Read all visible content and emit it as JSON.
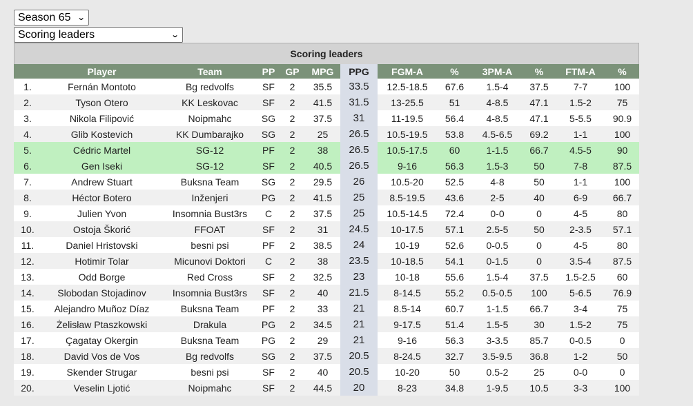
{
  "season_select": {
    "value": "Season 65"
  },
  "category_select": {
    "value": "Scoring leaders"
  },
  "table": {
    "caption": "Scoring leaders",
    "headers": [
      "",
      "Player",
      "Team",
      "PP",
      "GP",
      "MPG",
      "PPG",
      "FGM-A",
      "%",
      "3PM-A",
      "%",
      "FTM-A",
      "%"
    ],
    "rows": [
      {
        "rank": "1.",
        "player": "Fernán Montoto",
        "team": "Bg redvolfs",
        "pp": "SF",
        "gp": "2",
        "mpg": "35.5",
        "ppg": "33.5",
        "fgm": "12.5-18.5",
        "fgp": "67.6",
        "tpm": "1.5-4",
        "tpp": "37.5",
        "ftm": "7-7",
        "ftp": "100"
      },
      {
        "rank": "2.",
        "player": "Tyson Otero",
        "team": "KK Leskovac",
        "pp": "SF",
        "gp": "2",
        "mpg": "41.5",
        "ppg": "31.5",
        "fgm": "13-25.5",
        "fgp": "51",
        "tpm": "4-8.5",
        "tpp": "47.1",
        "ftm": "1.5-2",
        "ftp": "75"
      },
      {
        "rank": "3.",
        "player": "Nikola Filipović",
        "team": "Noipmahc",
        "pp": "SG",
        "gp": "2",
        "mpg": "37.5",
        "ppg": "31",
        "fgm": "11-19.5",
        "fgp": "56.4",
        "tpm": "4-8.5",
        "tpp": "47.1",
        "ftm": "5-5.5",
        "ftp": "90.9"
      },
      {
        "rank": "4.",
        "player": "Glib Kostevich",
        "team": "KK Dumbarajko",
        "pp": "SG",
        "gp": "2",
        "mpg": "25",
        "ppg": "26.5",
        "fgm": "10.5-19.5",
        "fgp": "53.8",
        "tpm": "4.5-6.5",
        "tpp": "69.2",
        "ftm": "1-1",
        "ftp": "100"
      },
      {
        "rank": "5.",
        "player": "Cédric Martel",
        "team": "SG-12",
        "pp": "PF",
        "gp": "2",
        "mpg": "38",
        "ppg": "26.5",
        "fgm": "10.5-17.5",
        "fgp": "60",
        "tpm": "1-1.5",
        "tpp": "66.7",
        "ftm": "4.5-5",
        "ftp": "90",
        "highlight": true
      },
      {
        "rank": "6.",
        "player": "Gen Iseki",
        "team": "SG-12",
        "pp": "SF",
        "gp": "2",
        "mpg": "40.5",
        "ppg": "26.5",
        "fgm": "9-16",
        "fgp": "56.3",
        "tpm": "1.5-3",
        "tpp": "50",
        "ftm": "7-8",
        "ftp": "87.5",
        "highlight": true
      },
      {
        "rank": "7.",
        "player": "Andrew Stuart",
        "team": "Buksna Team",
        "pp": "SG",
        "gp": "2",
        "mpg": "29.5",
        "ppg": "26",
        "fgm": "10.5-20",
        "fgp": "52.5",
        "tpm": "4-8",
        "tpp": "50",
        "ftm": "1-1",
        "ftp": "100"
      },
      {
        "rank": "8.",
        "player": "Héctor Botero",
        "team": "Inženjeri",
        "pp": "PG",
        "gp": "2",
        "mpg": "41.5",
        "ppg": "25",
        "fgm": "8.5-19.5",
        "fgp": "43.6",
        "tpm": "2-5",
        "tpp": "40",
        "ftm": "6-9",
        "ftp": "66.7"
      },
      {
        "rank": "9.",
        "player": "Julien Yvon",
        "team": "Insomnia Bust3rs",
        "pp": "C",
        "gp": "2",
        "mpg": "37.5",
        "ppg": "25",
        "fgm": "10.5-14.5",
        "fgp": "72.4",
        "tpm": "0-0",
        "tpp": "0",
        "ftm": "4-5",
        "ftp": "80"
      },
      {
        "rank": "10.",
        "player": "Ostoja Škorić",
        "team": "FFOAT",
        "pp": "SF",
        "gp": "2",
        "mpg": "31",
        "ppg": "24.5",
        "fgm": "10-17.5",
        "fgp": "57.1",
        "tpm": "2.5-5",
        "tpp": "50",
        "ftm": "2-3.5",
        "ftp": "57.1"
      },
      {
        "rank": "11.",
        "player": "Daniel Hristovski",
        "team": "besni psi",
        "pp": "PF",
        "gp": "2",
        "mpg": "38.5",
        "ppg": "24",
        "fgm": "10-19",
        "fgp": "52.6",
        "tpm": "0-0.5",
        "tpp": "0",
        "ftm": "4-5",
        "ftp": "80"
      },
      {
        "rank": "12.",
        "player": "Hotimir Tolar",
        "team": "Micunovi Doktori",
        "pp": "C",
        "gp": "2",
        "mpg": "38",
        "ppg": "23.5",
        "fgm": "10-18.5",
        "fgp": "54.1",
        "tpm": "0-1.5",
        "tpp": "0",
        "ftm": "3.5-4",
        "ftp": "87.5"
      },
      {
        "rank": "13.",
        "player": "Odd Borge",
        "team": "Red Cross",
        "pp": "SF",
        "gp": "2",
        "mpg": "32.5",
        "ppg": "23",
        "fgm": "10-18",
        "fgp": "55.6",
        "tpm": "1.5-4",
        "tpp": "37.5",
        "ftm": "1.5-2.5",
        "ftp": "60"
      },
      {
        "rank": "14.",
        "player": "Slobodan Stojadinov",
        "team": "Insomnia Bust3rs",
        "pp": "SF",
        "gp": "2",
        "mpg": "40",
        "ppg": "21.5",
        "fgm": "8-14.5",
        "fgp": "55.2",
        "tpm": "0.5-0.5",
        "tpp": "100",
        "ftm": "5-6.5",
        "ftp": "76.9"
      },
      {
        "rank": "15.",
        "player": "Alejandro Muñoz Díaz",
        "team": "Buksna Team",
        "pp": "PF",
        "gp": "2",
        "mpg": "33",
        "ppg": "21",
        "fgm": "8.5-14",
        "fgp": "60.7",
        "tpm": "1-1.5",
        "tpp": "66.7",
        "ftm": "3-4",
        "ftp": "75"
      },
      {
        "rank": "16.",
        "player": "Żelisław Ptaszkowski",
        "team": "Drakula",
        "pp": "PG",
        "gp": "2",
        "mpg": "34.5",
        "ppg": "21",
        "fgm": "9-17.5",
        "fgp": "51.4",
        "tpm": "1.5-5",
        "tpp": "30",
        "ftm": "1.5-2",
        "ftp": "75"
      },
      {
        "rank": "17.",
        "player": "Çagatay Okergin",
        "team": "Buksna Team",
        "pp": "PG",
        "gp": "2",
        "mpg": "29",
        "ppg": "21",
        "fgm": "9-16",
        "fgp": "56.3",
        "tpm": "3-3.5",
        "tpp": "85.7",
        "ftm": "0-0.5",
        "ftp": "0"
      },
      {
        "rank": "18.",
        "player": "David Vos de Vos",
        "team": "Bg redvolfs",
        "pp": "SG",
        "gp": "2",
        "mpg": "37.5",
        "ppg": "20.5",
        "fgm": "8-24.5",
        "fgp": "32.7",
        "tpm": "3.5-9.5",
        "tpp": "36.8",
        "ftm": "1-2",
        "ftp": "50"
      },
      {
        "rank": "19.",
        "player": "Skender Strugar",
        "team": "besni psi",
        "pp": "SF",
        "gp": "2",
        "mpg": "40",
        "ppg": "20.5",
        "fgm": "10-20",
        "fgp": "50",
        "tpm": "0.5-2",
        "tpp": "25",
        "ftm": "0-0",
        "ftp": "0"
      },
      {
        "rank": "20.",
        "player": "Veselin Ljotić",
        "team": "Noipmahc",
        "pp": "SF",
        "gp": "2",
        "mpg": "44.5",
        "ppg": "20",
        "fgm": "8-23",
        "fgp": "34.8",
        "tpm": "1-9.5",
        "tpp": "10.5",
        "ftm": "3-3",
        "ftp": "100"
      }
    ]
  }
}
